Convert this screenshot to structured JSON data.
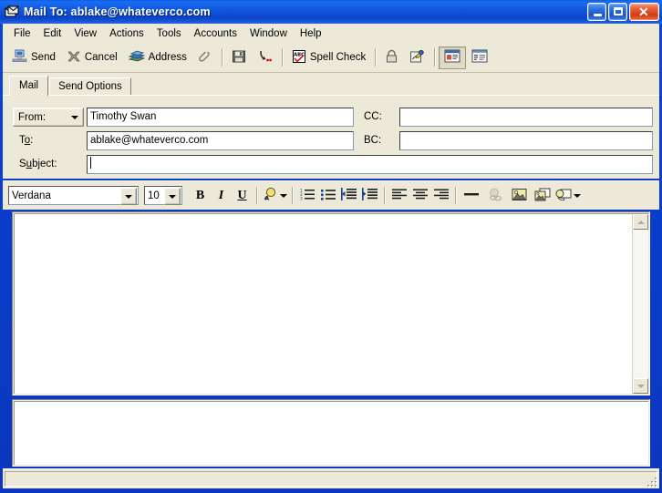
{
  "window": {
    "title": "Mail To: ablake@whateverco.com",
    "app_icon": "mail-envelope-icon",
    "minimize_label": "Minimize",
    "maximize_label": "Maximize",
    "close_label": "Close",
    "titlebar_color": "#0f56dc",
    "face_color": "#ece9d8",
    "close_button_color": "#d13c15"
  },
  "menu": {
    "items": [
      {
        "label": "File"
      },
      {
        "label": "Edit"
      },
      {
        "label": "View"
      },
      {
        "label": "Actions"
      },
      {
        "label": "Tools"
      },
      {
        "label": "Accounts"
      },
      {
        "label": "Window"
      },
      {
        "label": "Help"
      }
    ]
  },
  "toolbar": {
    "items": [
      {
        "label": "Send",
        "icon": "send-mail-icon"
      },
      {
        "label": "Cancel",
        "icon": "cancel-x-icon"
      },
      {
        "label": "Address",
        "icon": "address-book-icon"
      },
      {
        "label": "",
        "icon": "attach-paperclip-icon"
      },
      {
        "label": "",
        "icon": "save-floppy-icon"
      },
      {
        "label": "",
        "icon": "send-options-icon"
      },
      {
        "label": "Spell Check",
        "icon": "spell-check-icon"
      },
      {
        "label": "",
        "icon": "lock-security-icon"
      },
      {
        "label": "",
        "icon": "digital-signature-icon"
      },
      {
        "label": "",
        "icon": "html-view-icon",
        "pressed": true
      },
      {
        "label": "",
        "icon": "plain-text-view-icon",
        "pressed": false
      }
    ]
  },
  "tabs": [
    {
      "label": "Mail",
      "active": true
    },
    {
      "label": "Send Options",
      "active": false
    }
  ],
  "header_fields": {
    "from": {
      "label": "From:",
      "value": "Timothy Swan",
      "placeholder": ""
    },
    "to": {
      "label_pre": "T",
      "label_accel": "o",
      "label_post": ":",
      "value": "ablake@whateverco.com",
      "placeholder": ""
    },
    "subject": {
      "label_pre": "S",
      "label_accel": "u",
      "label_post": "bject:",
      "value": "",
      "placeholder": ""
    },
    "cc": {
      "label": "CC:",
      "value": "",
      "placeholder": ""
    },
    "bc": {
      "label": "BC:",
      "value": "",
      "placeholder": ""
    }
  },
  "format_toolbar": {
    "font_family": {
      "value": "Verdana"
    },
    "font_size": {
      "value": "10"
    },
    "buttons": [
      {
        "name": "bold",
        "glyph": "B"
      },
      {
        "name": "italic",
        "glyph": "I"
      },
      {
        "name": "underline",
        "glyph": "U"
      },
      {
        "name": "font-color",
        "glyph": ""
      },
      {
        "name": "numbered-list",
        "glyph": ""
      },
      {
        "name": "bulleted-list",
        "glyph": ""
      },
      {
        "name": "decrease-indent",
        "glyph": ""
      },
      {
        "name": "increase-indent",
        "glyph": ""
      },
      {
        "name": "align-left",
        "glyph": ""
      },
      {
        "name": "align-center",
        "glyph": ""
      },
      {
        "name": "align-right",
        "glyph": ""
      },
      {
        "name": "horizontal-rule",
        "glyph": ""
      },
      {
        "name": "insert-link",
        "glyph": ""
      },
      {
        "name": "insert-image",
        "glyph": ""
      },
      {
        "name": "insert-background-image",
        "glyph": ""
      },
      {
        "name": "insert-object",
        "glyph": ""
      }
    ]
  },
  "body": {
    "text": "",
    "scroll_up_label": "Scroll up",
    "scroll_down_label": "Scroll down"
  },
  "attachments": {
    "items": []
  },
  "status_bar": {
    "text": ""
  }
}
